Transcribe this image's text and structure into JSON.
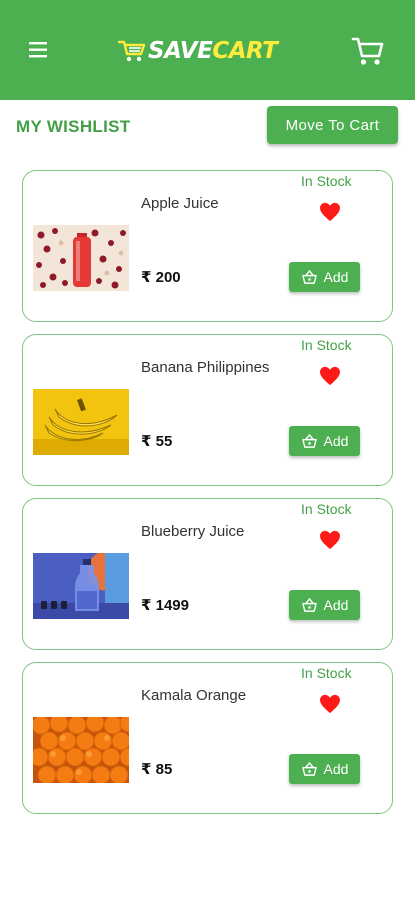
{
  "header": {
    "logo_save": "SAVE",
    "logo_cart": "CART",
    "menu_icon": "hamburger-menu-icon",
    "cart_icon": "shopping-cart-icon",
    "colors": {
      "primary": "#4caf50",
      "logo_accent": "#ffeb3b"
    }
  },
  "wishlist": {
    "title": "MY WISHLIST",
    "move_to_cart_label": "Move To Cart"
  },
  "items": [
    {
      "name": "Apple Juice",
      "price": "₹ 200",
      "stock": "In Stock",
      "add_label": "Add",
      "image": "apple-juice-bottle"
    },
    {
      "name": "Banana Philippines",
      "price": "₹ 55",
      "stock": "In Stock",
      "add_label": "Add",
      "image": "bananas"
    },
    {
      "name": "Blueberry Juice",
      "price": "₹ 1499",
      "stock": "In Stock",
      "add_label": "Add",
      "image": "blueberry-juice-bottle"
    },
    {
      "name": "Kamala Orange",
      "price": "₹ 85",
      "stock": "In Stock",
      "add_label": "Add",
      "image": "oranges"
    }
  ],
  "icons": {
    "favorite": "heart-icon",
    "add_to_basket": "basket-icon"
  },
  "colors": {
    "heart": "#ff1a1a",
    "card_border": "#81c784",
    "stock_text": "#43a047"
  }
}
